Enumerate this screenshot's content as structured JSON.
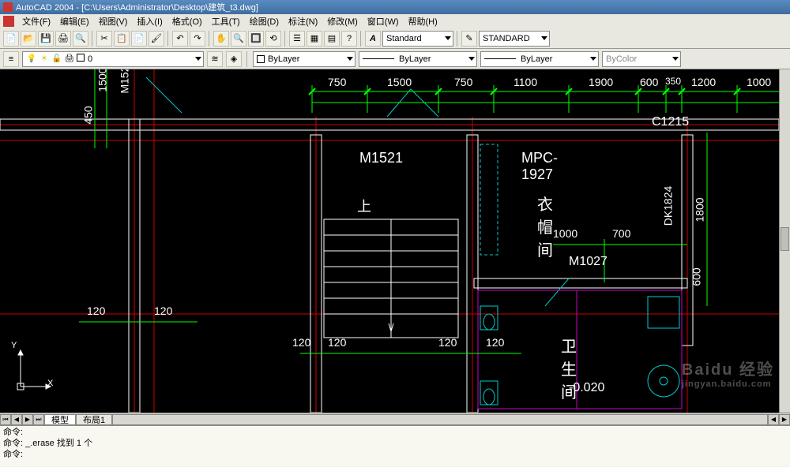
{
  "title": "AutoCAD 2004 - [C:\\Users\\Administrator\\Desktop\\建筑_t3.dwg]",
  "menubar": {
    "items": [
      "文件(F)",
      "编辑(E)",
      "视图(V)",
      "插入(I)",
      "格式(O)",
      "工具(T)",
      "绘图(D)",
      "标注(N)",
      "修改(M)",
      "窗口(W)",
      "帮助(H)"
    ]
  },
  "toolbar_style": {
    "font_icon": "A",
    "style1": "Standard",
    "pen_icon": "✎",
    "style2": "STANDARD"
  },
  "layer_panel": {
    "layer_name": "0",
    "linetype": "ByLayer",
    "lineweight": "ByLayer",
    "plotstyle": "ByLayer",
    "color": "ByColor"
  },
  "tabs": {
    "model": "模型",
    "layout1": "布局1"
  },
  "command_window": {
    "line1": "命令:",
    "line2": "命令: _.erase 找到 1 个",
    "line3": "命令:"
  },
  "drawing_labels": {
    "top_dims": [
      "750",
      "1500",
      "750",
      "1100",
      "1900",
      "600",
      "350",
      "1200",
      "1000"
    ],
    "left_dims": [
      "450",
      "1500"
    ],
    "vert_text1": "M152",
    "m1521": "M1521",
    "shang": "上",
    "mpc": "MPC-1927",
    "yimao": "衣帽间",
    "m1027": "M1027",
    "dk1824": "DK1824",
    "c1215": "C1215",
    "dim1000": "1000",
    "dim700": "700",
    "dim1800": "1800",
    "dim600": "600",
    "wall120a": "120",
    "wall120b": "120",
    "wall120c": "120",
    "wall120d": "120",
    "wall120e": "120",
    "wall120f": "120",
    "weisheng": "卫生间",
    "level": "-0.020"
  },
  "ucs": {
    "x": "X",
    "y": "Y"
  },
  "watermark": {
    "main": "Baidu 经验",
    "sub": "jingyan.baidu.com"
  }
}
